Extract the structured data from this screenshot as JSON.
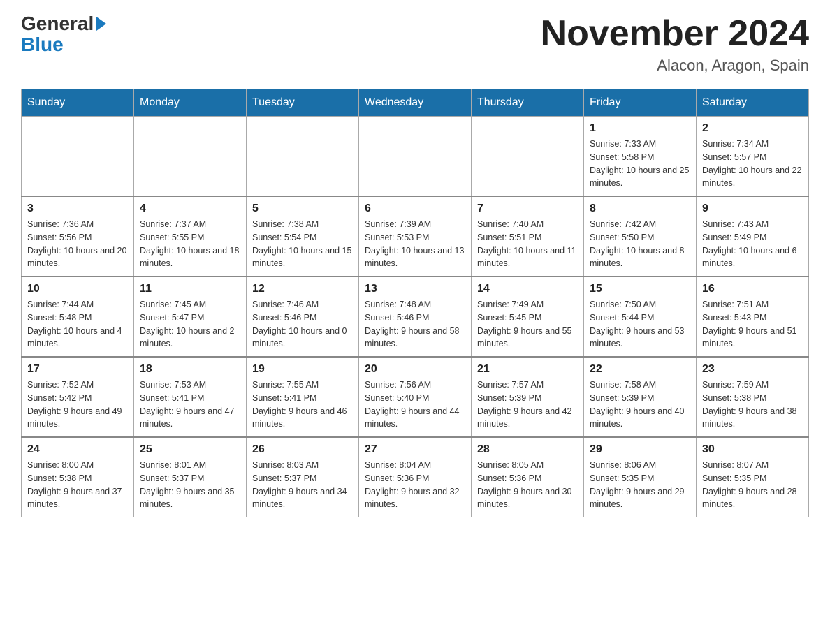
{
  "header": {
    "logo_general": "General",
    "logo_blue": "Blue",
    "month_title": "November 2024",
    "location": "Alacon, Aragon, Spain"
  },
  "days_of_week": [
    "Sunday",
    "Monday",
    "Tuesday",
    "Wednesday",
    "Thursday",
    "Friday",
    "Saturday"
  ],
  "weeks": [
    [
      {
        "day": "",
        "sunrise": "",
        "sunset": "",
        "daylight": ""
      },
      {
        "day": "",
        "sunrise": "",
        "sunset": "",
        "daylight": ""
      },
      {
        "day": "",
        "sunrise": "",
        "sunset": "",
        "daylight": ""
      },
      {
        "day": "",
        "sunrise": "",
        "sunset": "",
        "daylight": ""
      },
      {
        "day": "",
        "sunrise": "",
        "sunset": "",
        "daylight": ""
      },
      {
        "day": "1",
        "sunrise": "Sunrise: 7:33 AM",
        "sunset": "Sunset: 5:58 PM",
        "daylight": "Daylight: 10 hours and 25 minutes."
      },
      {
        "day": "2",
        "sunrise": "Sunrise: 7:34 AM",
        "sunset": "Sunset: 5:57 PM",
        "daylight": "Daylight: 10 hours and 22 minutes."
      }
    ],
    [
      {
        "day": "3",
        "sunrise": "Sunrise: 7:36 AM",
        "sunset": "Sunset: 5:56 PM",
        "daylight": "Daylight: 10 hours and 20 minutes."
      },
      {
        "day": "4",
        "sunrise": "Sunrise: 7:37 AM",
        "sunset": "Sunset: 5:55 PM",
        "daylight": "Daylight: 10 hours and 18 minutes."
      },
      {
        "day": "5",
        "sunrise": "Sunrise: 7:38 AM",
        "sunset": "Sunset: 5:54 PM",
        "daylight": "Daylight: 10 hours and 15 minutes."
      },
      {
        "day": "6",
        "sunrise": "Sunrise: 7:39 AM",
        "sunset": "Sunset: 5:53 PM",
        "daylight": "Daylight: 10 hours and 13 minutes."
      },
      {
        "day": "7",
        "sunrise": "Sunrise: 7:40 AM",
        "sunset": "Sunset: 5:51 PM",
        "daylight": "Daylight: 10 hours and 11 minutes."
      },
      {
        "day": "8",
        "sunrise": "Sunrise: 7:42 AM",
        "sunset": "Sunset: 5:50 PM",
        "daylight": "Daylight: 10 hours and 8 minutes."
      },
      {
        "day": "9",
        "sunrise": "Sunrise: 7:43 AM",
        "sunset": "Sunset: 5:49 PM",
        "daylight": "Daylight: 10 hours and 6 minutes."
      }
    ],
    [
      {
        "day": "10",
        "sunrise": "Sunrise: 7:44 AM",
        "sunset": "Sunset: 5:48 PM",
        "daylight": "Daylight: 10 hours and 4 minutes."
      },
      {
        "day": "11",
        "sunrise": "Sunrise: 7:45 AM",
        "sunset": "Sunset: 5:47 PM",
        "daylight": "Daylight: 10 hours and 2 minutes."
      },
      {
        "day": "12",
        "sunrise": "Sunrise: 7:46 AM",
        "sunset": "Sunset: 5:46 PM",
        "daylight": "Daylight: 10 hours and 0 minutes."
      },
      {
        "day": "13",
        "sunrise": "Sunrise: 7:48 AM",
        "sunset": "Sunset: 5:46 PM",
        "daylight": "Daylight: 9 hours and 58 minutes."
      },
      {
        "day": "14",
        "sunrise": "Sunrise: 7:49 AM",
        "sunset": "Sunset: 5:45 PM",
        "daylight": "Daylight: 9 hours and 55 minutes."
      },
      {
        "day": "15",
        "sunrise": "Sunrise: 7:50 AM",
        "sunset": "Sunset: 5:44 PM",
        "daylight": "Daylight: 9 hours and 53 minutes."
      },
      {
        "day": "16",
        "sunrise": "Sunrise: 7:51 AM",
        "sunset": "Sunset: 5:43 PM",
        "daylight": "Daylight: 9 hours and 51 minutes."
      }
    ],
    [
      {
        "day": "17",
        "sunrise": "Sunrise: 7:52 AM",
        "sunset": "Sunset: 5:42 PM",
        "daylight": "Daylight: 9 hours and 49 minutes."
      },
      {
        "day": "18",
        "sunrise": "Sunrise: 7:53 AM",
        "sunset": "Sunset: 5:41 PM",
        "daylight": "Daylight: 9 hours and 47 minutes."
      },
      {
        "day": "19",
        "sunrise": "Sunrise: 7:55 AM",
        "sunset": "Sunset: 5:41 PM",
        "daylight": "Daylight: 9 hours and 46 minutes."
      },
      {
        "day": "20",
        "sunrise": "Sunrise: 7:56 AM",
        "sunset": "Sunset: 5:40 PM",
        "daylight": "Daylight: 9 hours and 44 minutes."
      },
      {
        "day": "21",
        "sunrise": "Sunrise: 7:57 AM",
        "sunset": "Sunset: 5:39 PM",
        "daylight": "Daylight: 9 hours and 42 minutes."
      },
      {
        "day": "22",
        "sunrise": "Sunrise: 7:58 AM",
        "sunset": "Sunset: 5:39 PM",
        "daylight": "Daylight: 9 hours and 40 minutes."
      },
      {
        "day": "23",
        "sunrise": "Sunrise: 7:59 AM",
        "sunset": "Sunset: 5:38 PM",
        "daylight": "Daylight: 9 hours and 38 minutes."
      }
    ],
    [
      {
        "day": "24",
        "sunrise": "Sunrise: 8:00 AM",
        "sunset": "Sunset: 5:38 PM",
        "daylight": "Daylight: 9 hours and 37 minutes."
      },
      {
        "day": "25",
        "sunrise": "Sunrise: 8:01 AM",
        "sunset": "Sunset: 5:37 PM",
        "daylight": "Daylight: 9 hours and 35 minutes."
      },
      {
        "day": "26",
        "sunrise": "Sunrise: 8:03 AM",
        "sunset": "Sunset: 5:37 PM",
        "daylight": "Daylight: 9 hours and 34 minutes."
      },
      {
        "day": "27",
        "sunrise": "Sunrise: 8:04 AM",
        "sunset": "Sunset: 5:36 PM",
        "daylight": "Daylight: 9 hours and 32 minutes."
      },
      {
        "day": "28",
        "sunrise": "Sunrise: 8:05 AM",
        "sunset": "Sunset: 5:36 PM",
        "daylight": "Daylight: 9 hours and 30 minutes."
      },
      {
        "day": "29",
        "sunrise": "Sunrise: 8:06 AM",
        "sunset": "Sunset: 5:35 PM",
        "daylight": "Daylight: 9 hours and 29 minutes."
      },
      {
        "day": "30",
        "sunrise": "Sunrise: 8:07 AM",
        "sunset": "Sunset: 5:35 PM",
        "daylight": "Daylight: 9 hours and 28 minutes."
      }
    ]
  ]
}
